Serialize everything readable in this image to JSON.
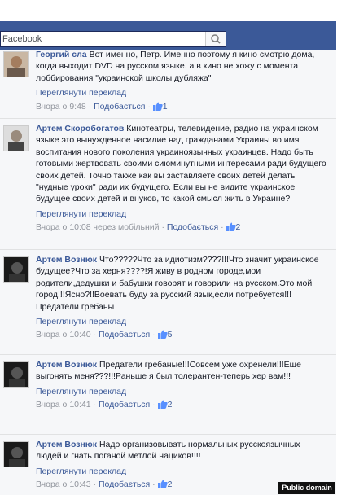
{
  "search": {
    "placeholder": "Facebook"
  },
  "comments": [
    {
      "author": "Георгий сла",
      "text": "Вот именно, Петр. Именно поэтому я кино смотрю дома, когда выходит DVD на русском языке. а в кино не хожу с момента лоббирования \"украинской школы дубляжа\"",
      "translate": "Переглянути переклад",
      "time": "Вчора о 9:48",
      "like_label": "Подобається",
      "likes": "1"
    },
    {
      "author": "Артем Скоробогатов",
      "text": "Кинотеатры, телевидение, радио на украинском языке это вынужденное насилие над гражданами Украины во имя воспитания нового поколения украиноязычных украинцев. Надо быть готовыми жертвовать своими сиюминутными интересами ради будущего своих детей. Точно также как вы заставляете своих детей делать \"нудные уроки\" ради их будущего. Если вы не видите украинское будущее своих детей и внуков, то какой смысл жить в Украине?",
      "translate": "Переглянути переклад",
      "time": "Вчора о 10:08 через мобільний",
      "like_label": "Подобається",
      "likes": "2"
    },
    {
      "author": "Артем Вознюк",
      "text": "Что?????Что за идиотизм????!!!Что значит украинское будущее?Что за херня????!Я живу в родном городе,мои родители,дедушки и бабушки говорят и говорили на русском.Это мой город!!!Ясно?!!Воевать буду за русский язык,если потребуется!!!Предатели гребаны",
      "translate": "Переглянути переклад",
      "time": "Вчора о 10:40",
      "like_label": "Подобається",
      "likes": "5"
    },
    {
      "author": "Артем Вознюк",
      "text": "Предатели гребаные!!!Совсем уже охренели!!!Еще выгонять меня???!!!Раньше я был толерантен-теперь хер вам!!!",
      "translate": "Переглянути переклад",
      "time": "Вчора о 10:41",
      "like_label": "Подобається",
      "likes": "2"
    },
    {
      "author": "Артем Вознюк",
      "text": "Надо организовывать нормальных русскоязычных людей и гнать поганой метлой нациков!!!!",
      "translate": "Переглянути переклад",
      "time": "Вчора о 10:43",
      "like_label": "Подобається",
      "likes": "2"
    }
  ],
  "badge": "Public domain",
  "colors": {
    "brand": "#3b5998",
    "link": "#3b5998",
    "meta": "#90949c",
    "feed_bg": "#f6f7f9"
  }
}
